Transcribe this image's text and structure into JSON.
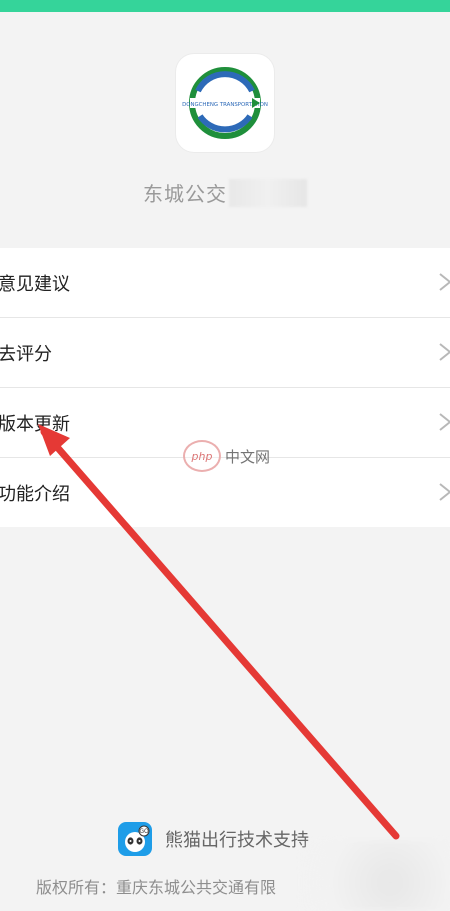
{
  "app": {
    "name_visible": "东城公交",
    "logo_text": "DONGCHENG TRANSPORTATION"
  },
  "menu": {
    "items": [
      {
        "label": "意见建议"
      },
      {
        "label": "去评分"
      },
      {
        "label": "版本更新"
      },
      {
        "label": "功能介绍"
      }
    ]
  },
  "watermark": {
    "left": "php",
    "right": "中文网"
  },
  "footer": {
    "support_label": "熊猫出行技术支持",
    "copyright": "版权所有：重庆东城公共交通有限"
  },
  "colors": {
    "top_bar": "#35d49a",
    "arrow": "#e53935",
    "panda_icon_bg": "#1e9de8"
  },
  "icons": {
    "chevron": "chevron-right-icon",
    "panda": "panda-icon"
  }
}
